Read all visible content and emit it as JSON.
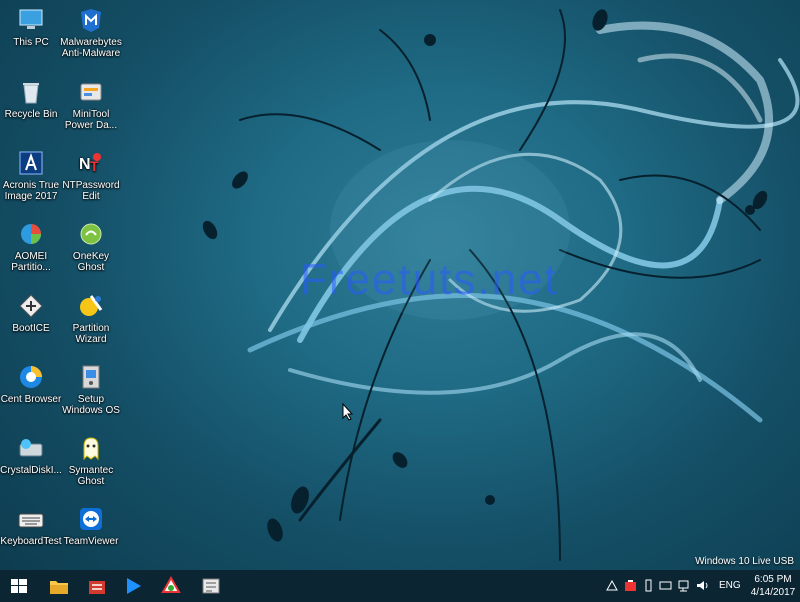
{
  "desktop": {
    "icons": [
      {
        "label": "This PC",
        "icon": "this-pc-icon"
      },
      {
        "label": "Malwarebytes Anti-Malware",
        "icon": "malwarebytes-icon"
      },
      {
        "label": "Recycle Bin",
        "icon": "recycle-bin-icon"
      },
      {
        "label": "MiniTool Power Da...",
        "icon": "minitool-icon"
      },
      {
        "label": "Acronis True Image 2017",
        "icon": "acronis-icon"
      },
      {
        "label": "NTPassword Edit",
        "icon": "ntpassword-icon"
      },
      {
        "label": "AOMEI Partitio...",
        "icon": "aomei-icon"
      },
      {
        "label": "OneKey Ghost",
        "icon": "onekey-ghost-icon"
      },
      {
        "label": "BootICE",
        "icon": "bootice-icon"
      },
      {
        "label": "Partition Wizard",
        "icon": "partition-wizard-icon"
      },
      {
        "label": "Cent Browser",
        "icon": "cent-browser-icon"
      },
      {
        "label": "Setup Windows OS",
        "icon": "setup-windows-icon"
      },
      {
        "label": "CrystalDiskI...",
        "icon": "crystaldisk-icon"
      },
      {
        "label": "Symantec Ghost",
        "icon": "symantec-ghost-icon"
      },
      {
        "label": "KeyboardTest",
        "icon": "keyboard-icon"
      },
      {
        "label": "TeamViewer",
        "icon": "teamviewer-icon"
      }
    ],
    "watermark": "Freetuts.net",
    "os_label": "Windows 10 Live USB"
  },
  "taskbar": {
    "items": [
      "start-icon",
      "file-explorer-icon",
      "toolbox-icon",
      "media-player-icon",
      "app-icon",
      "language-bar-icon"
    ],
    "tray": [
      "volume-icon"
    ],
    "language": "ENG",
    "time": "6:05 PM",
    "date": "4/14/2017"
  },
  "colors": {
    "taskbar": "#0b2533",
    "desktop_bg": "#1f6a84"
  }
}
